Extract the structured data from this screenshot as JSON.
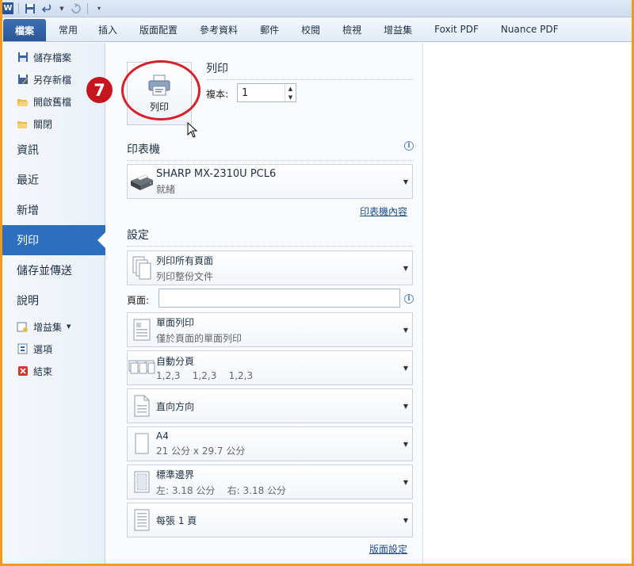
{
  "qat": {
    "logo": "W"
  },
  "tabs": [
    {
      "label": "檔案"
    },
    {
      "label": "常用"
    },
    {
      "label": "插入"
    },
    {
      "label": "版面配置"
    },
    {
      "label": "參考資料"
    },
    {
      "label": "郵件"
    },
    {
      "label": "校閱"
    },
    {
      "label": "檢視"
    },
    {
      "label": "增益集"
    },
    {
      "label": "Foxit PDF"
    },
    {
      "label": "Nuance PDF"
    }
  ],
  "nav": {
    "save": "儲存檔案",
    "save_as": "另存新檔",
    "open": "開啟舊檔",
    "close": "關閉",
    "info": "資訊",
    "recent": "最近",
    "new": "新增",
    "print": "列印",
    "save_send": "儲存並傳送",
    "help": "說明",
    "addins": "增益集",
    "options": "選項",
    "exit": "結束"
  },
  "print": {
    "section_title": "列印",
    "button_label": "列印",
    "step_number": "7",
    "copies_label": "複本:",
    "copies_value": "1"
  },
  "printer": {
    "section_title": "印表機",
    "name": "SHARP MX-2310U PCL6",
    "status": "就緒",
    "properties_link": "印表機內容"
  },
  "settings": {
    "section_title": "設定",
    "print_all": {
      "title": "列印所有頁面",
      "subtitle": "列印整份文件"
    },
    "pages_label": "頁面:",
    "pages_value": "",
    "sides": {
      "title": "單面列印",
      "subtitle": "僅於頁面的單面列印"
    },
    "collate": {
      "title": "自動分頁",
      "subtitle": "1,2,3    1,2,3    1,2,3"
    },
    "orientation": {
      "title": "直向方向"
    },
    "paper": {
      "title": "A4",
      "subtitle": "21 公分 x 29.7 公分"
    },
    "margins": {
      "title": "標準邊界",
      "subtitle": "左: 3.18 公分    右: 3.18 公分"
    },
    "per_sheet": {
      "title": "每張 1 頁"
    },
    "page_setup_link": "版面設定"
  },
  "colors": {
    "accent": "#2d6fbf",
    "frame": "#f29a1e",
    "badge": "#c4161c"
  }
}
